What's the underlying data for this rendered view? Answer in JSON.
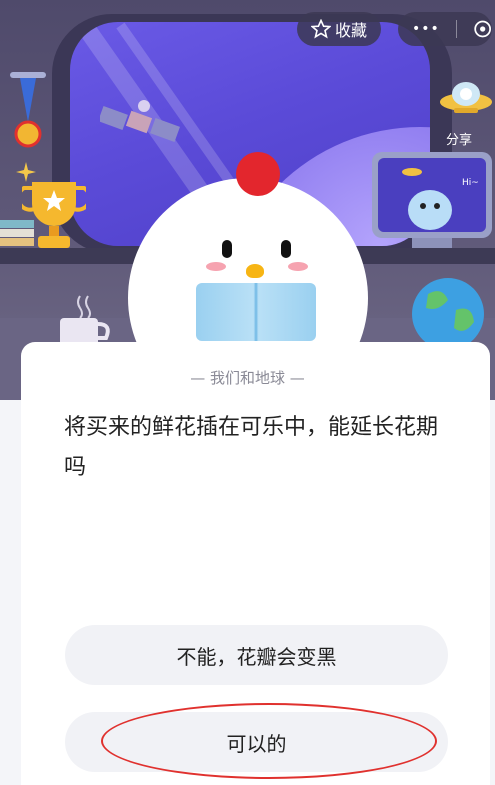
{
  "header": {
    "favorite_label": "收藏",
    "more_label": "•••",
    "share_label": "分享"
  },
  "scene": {
    "greeting": "Hi~"
  },
  "quiz": {
    "category": "— 我们和地球 —",
    "question": "将买来的鲜花插在可乐中，能延长花期吗",
    "options": [
      {
        "label": "不能，花瓣会变黑"
      },
      {
        "label": "可以的"
      }
    ]
  },
  "colors": {
    "accent_red": "#e0312e",
    "window_purple": "#5b4bd8",
    "option_bg": "#f1f2f6"
  }
}
